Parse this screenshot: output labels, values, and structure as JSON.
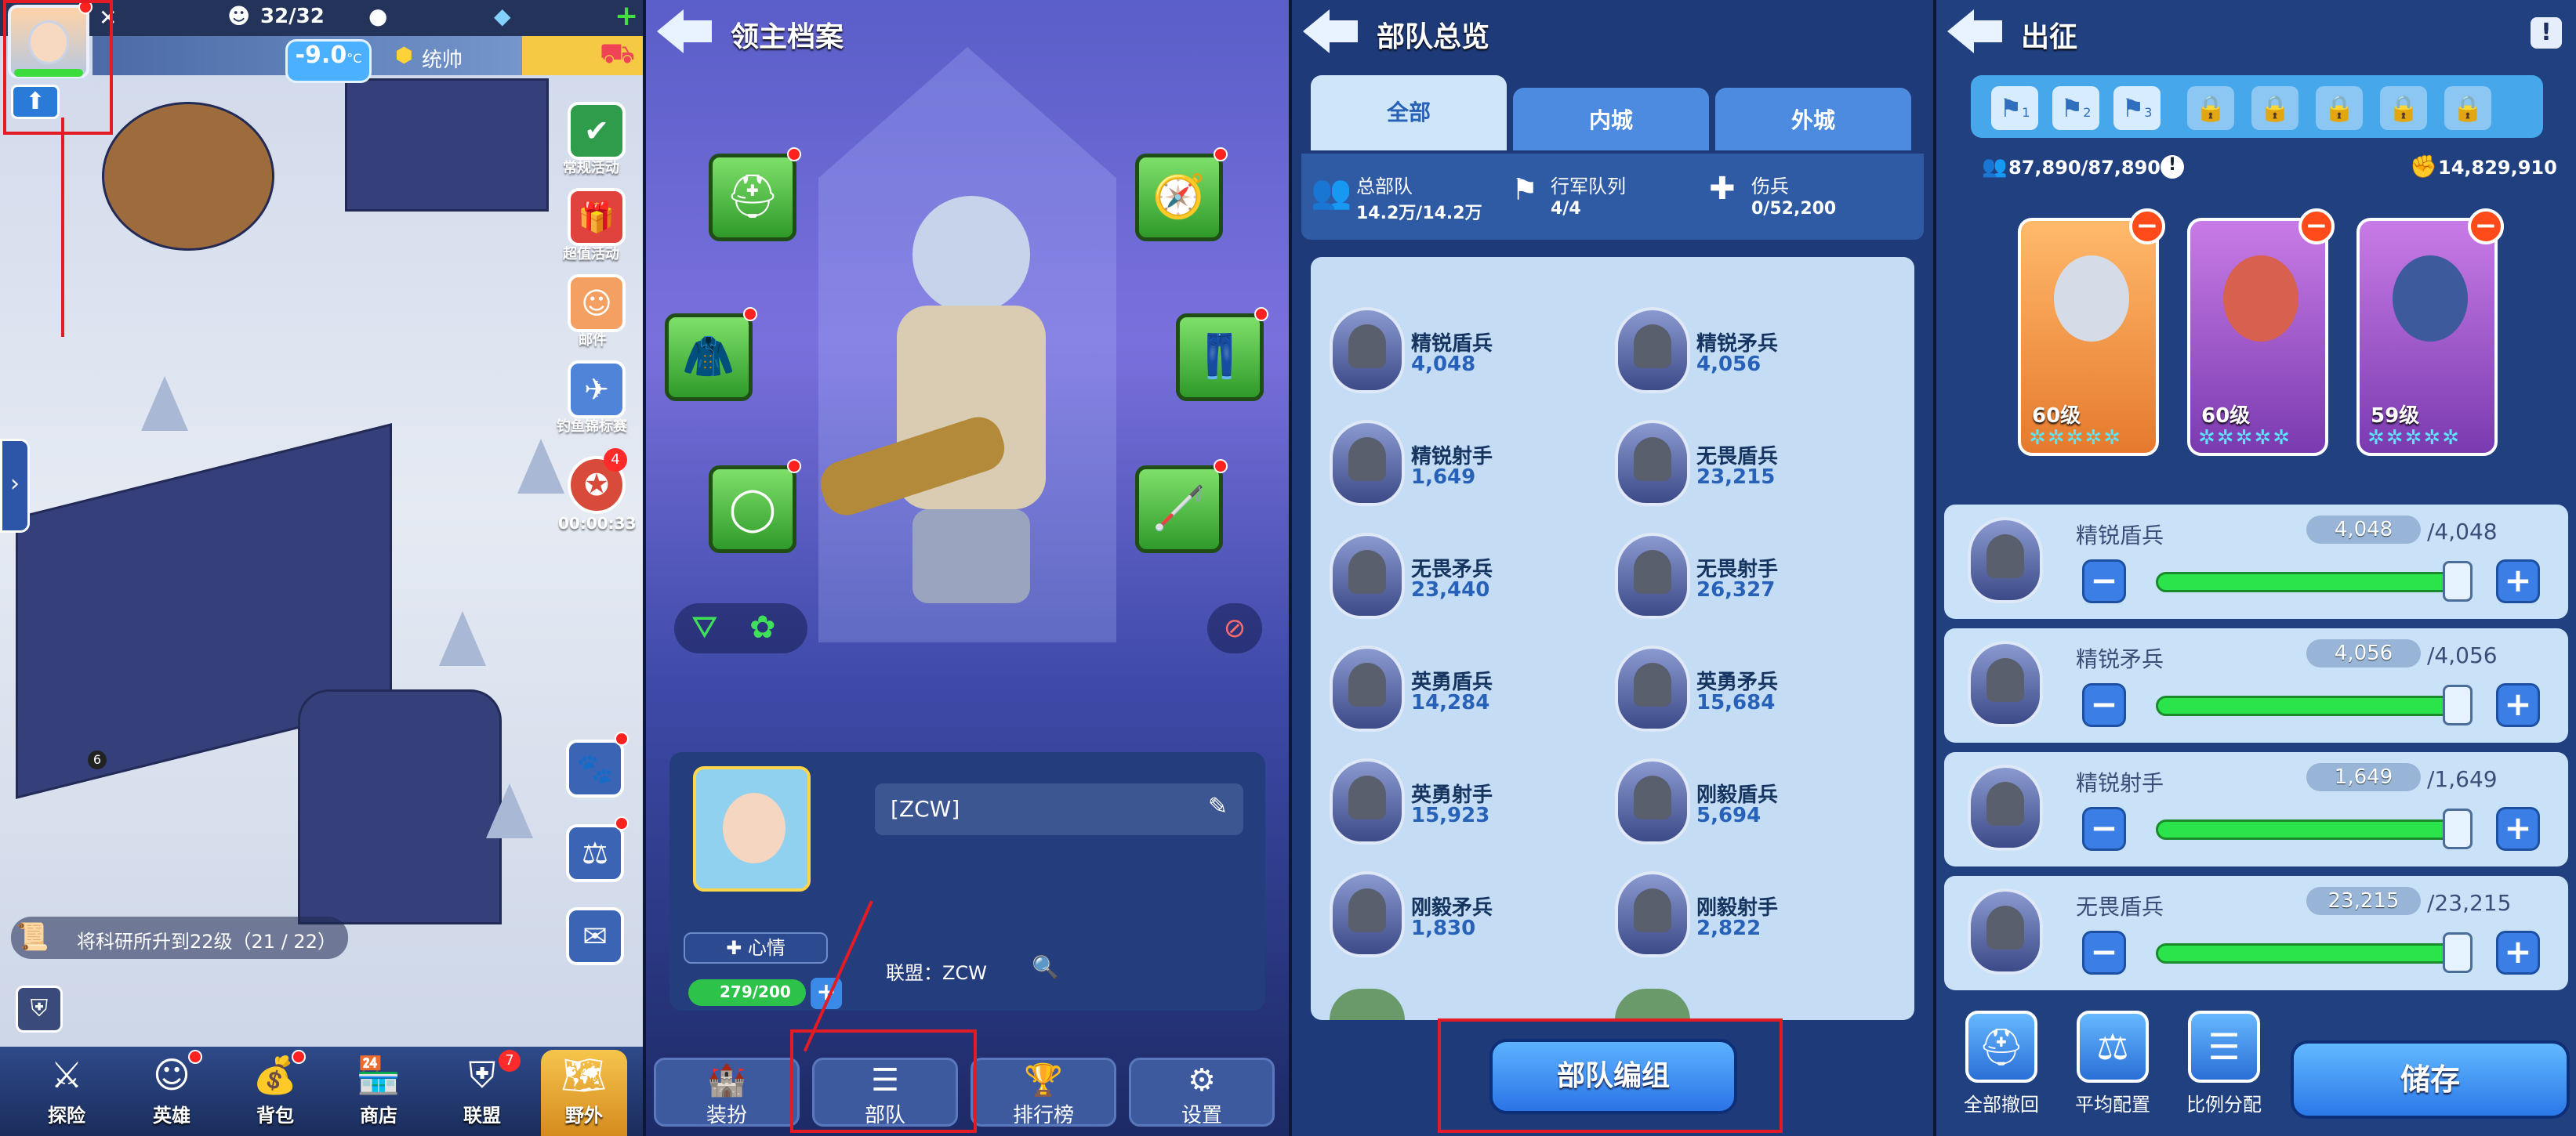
{
  "city": {
    "troops": "32/32",
    "temperature": "-9.0",
    "temp_unit": "°C",
    "commander_label": "统帅",
    "side_labels": [
      "常规活动",
      "超值活动",
      "邮件",
      "钓鱼锦标赛",
      "00:00:33"
    ],
    "event_badge": "4",
    "research_text": "将科研所升到22级（21 / 22）",
    "badge_num": "6",
    "nav": [
      "探险",
      "英雄",
      "背包",
      "商店",
      "联盟",
      "野外"
    ],
    "alliance_badge": "7"
  },
  "lord": {
    "title": "领主档案",
    "name": "[ZCW]",
    "mood_label": "✚ 心情",
    "energy": "279/200",
    "alliance": "联盟：ZCW",
    "tabs": [
      "装扮",
      "部队",
      "排行榜",
      "设置"
    ]
  },
  "army": {
    "title": "部队总览",
    "tabs": [
      "全部",
      "内城",
      "外城"
    ],
    "stats": [
      {
        "label": "总部队",
        "value": "14.2万/14.2万"
      },
      {
        "label": "行军队列",
        "value": "4/4"
      },
      {
        "label": "伤兵",
        "value": "0/52,200"
      }
    ],
    "units": [
      {
        "name": "精锐盾兵",
        "count": "4,048"
      },
      {
        "name": "精锐矛兵",
        "count": "4,056"
      },
      {
        "name": "精锐射手",
        "count": "1,649"
      },
      {
        "name": "无畏盾兵",
        "count": "23,215"
      },
      {
        "name": "无畏矛兵",
        "count": "23,440"
      },
      {
        "name": "无畏射手",
        "count": "26,327"
      },
      {
        "name": "英勇盾兵",
        "count": "14,284"
      },
      {
        "name": "英勇矛兵",
        "count": "15,684"
      },
      {
        "name": "英勇射手",
        "count": "15,923"
      },
      {
        "name": "刚毅盾兵",
        "count": "5,694"
      },
      {
        "name": "刚毅矛兵",
        "count": "1,830"
      },
      {
        "name": "刚毅射手",
        "count": "2,822"
      }
    ],
    "button": "部队编组"
  },
  "march": {
    "title": "出征",
    "slots": [
      "1",
      "2",
      "3"
    ],
    "capacity": "87,890/87,890",
    "power": "14,829,910",
    "heroes": [
      {
        "level": "60级",
        "stars": "✲✲✲✲✲"
      },
      {
        "level": "60级",
        "stars": "✲✲✲✲✲"
      },
      {
        "level": "59级",
        "stars": "✲✲✲✲✲"
      }
    ],
    "rows": [
      {
        "name": "精锐盾兵",
        "count": "4,048",
        "max": "/4,048",
        "fill": 1.0
      },
      {
        "name": "精锐矛兵",
        "count": "4,056",
        "max": "/4,056",
        "fill": 1.0
      },
      {
        "name": "精锐射手",
        "count": "1,649",
        "max": "/1,649",
        "fill": 1.0
      },
      {
        "name": "无畏盾兵",
        "count": "23,215",
        "max": "/23,215",
        "fill": 1.0
      }
    ],
    "footer": [
      "全部撤回",
      "平均配置",
      "比例分配"
    ],
    "save": "储存"
  }
}
